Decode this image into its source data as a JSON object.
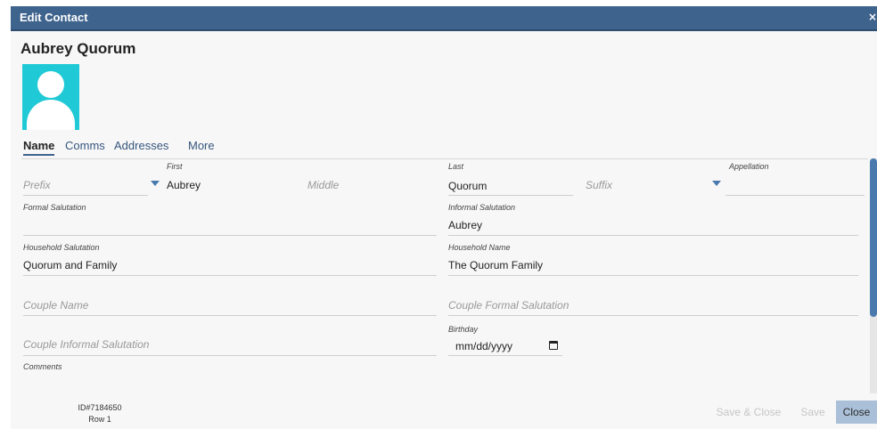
{
  "window": {
    "title": "Edit Contact",
    "close_glyph": "×"
  },
  "contact": {
    "display_name": "Aubrey Quorum"
  },
  "tabs": [
    {
      "label": "Name",
      "active": true
    },
    {
      "label": "Comms",
      "active": false
    },
    {
      "label": "Addresses",
      "active": false
    },
    {
      "label": "More",
      "active": false
    }
  ],
  "fields": {
    "prefix": {
      "placeholder": "Prefix"
    },
    "first": {
      "label": "First",
      "value": "Aubrey"
    },
    "middle": {
      "placeholder": "Middle"
    },
    "last": {
      "label": "Last",
      "value": "Quorum"
    },
    "suffix": {
      "placeholder": "Suffix"
    },
    "appellation": {
      "label": "Appellation",
      "value": ""
    },
    "formal_salutation": {
      "label": "Formal Salutation",
      "value": ""
    },
    "informal_salutation": {
      "label": "Informal Salutation",
      "value": "Aubrey"
    },
    "household_salutation": {
      "label": "Household Salutation",
      "value": "Quorum and Family"
    },
    "household_name": {
      "label": "Household Name",
      "value": "The Quorum Family"
    },
    "couple_name": {
      "placeholder": "Couple Name"
    },
    "couple_formal_salutation": {
      "placeholder": "Couple Formal Salutation"
    },
    "couple_informal_salutation": {
      "placeholder": "Couple Informal Salutation"
    },
    "birthday": {
      "label": "Birthday",
      "value": "mm/dd/yyyy"
    },
    "comments": {
      "label": "Comments",
      "value": ""
    }
  },
  "footer": {
    "record_id": "ID#7184650",
    "row": "Row 1",
    "save_close_label": "Save & Close",
    "save_label": "Save",
    "close_label": "Close"
  },
  "colors": {
    "title_bar": "#3e638d",
    "avatar_bg": "#1fcad6",
    "accent": "#4a79ad",
    "close_button": "#aac0d8"
  },
  "icons": [
    "close-icon",
    "avatar-icon",
    "chevron-down-icon",
    "calendar-icon"
  ]
}
